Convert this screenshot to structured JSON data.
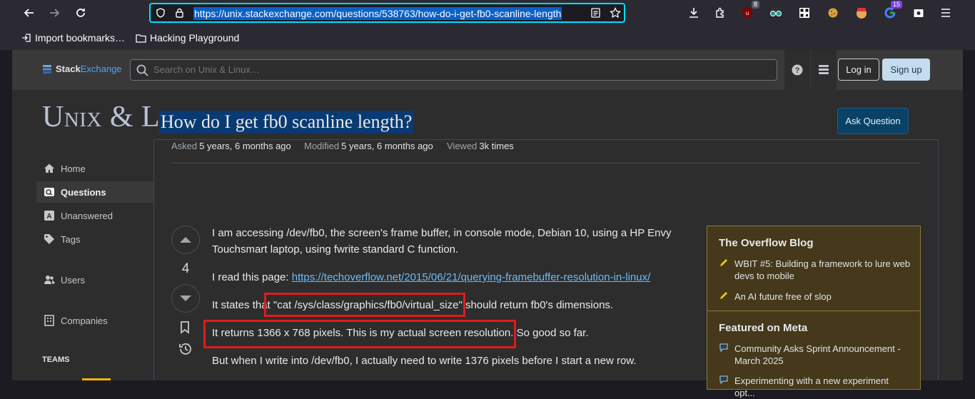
{
  "browser": {
    "url": "https://unix.stackexchange.com/questions/538763/how-do-i-get-fb0-scanline-length",
    "ext_badges": {
      "ublock": "8",
      "google": "15"
    },
    "bookmarks": [
      "Import bookmarks…",
      "Hacking Playground"
    ]
  },
  "site": {
    "logo_part1": "Stack",
    "logo_part2": "Exchange",
    "search_placeholder": "Search on Unix & Linux…",
    "login": "Log in",
    "signup": "Sign up",
    "name": "Unix & Linux"
  },
  "nav": {
    "items": [
      {
        "label": "Home",
        "icon": "home-icon"
      },
      {
        "label": "Questions",
        "icon": "questions-icon"
      },
      {
        "label": "Unanswered",
        "icon": "unanswered-icon"
      },
      {
        "label": "Tags",
        "icon": "tag-icon"
      },
      {
        "label": "Users",
        "icon": "users-icon"
      },
      {
        "label": "Companies",
        "icon": "companies-icon"
      }
    ],
    "teams": "TEAMS"
  },
  "question": {
    "title": "How do I get fb0 scanline length?",
    "ask_button": "Ask Question",
    "asked_label": "Asked",
    "asked_value": "5 years, 6 months ago",
    "modified_label": "Modified",
    "modified_value": "5 years, 6 months ago",
    "viewed_label": "Viewed",
    "viewed_value": "3k times",
    "score": "4",
    "p1": "I am accessing /dev/fb0, the screen's frame buffer, in console mode, Debian 10, using a HP Envy Touchsmart laptop, using fwrite standard C function.",
    "p2_prefix": "I read this page: ",
    "p2_link": "https://techoverflow.net/2015/06/21/querying-framebuffer-resolution-in-linux/",
    "p3": "It states that \"cat /sys/class/graphics/fb0/virtual_size\" should return fb0's dimensions.",
    "p4": "It returns 1366 x 768 pixels. This is my actual screen resolution. So good so far.",
    "p5": "But when I write into /dev/fb0, I actually need to write 1376 pixels before I start a new row."
  },
  "sidebar": {
    "blog_title": "The Overflow Blog",
    "blog_items": [
      "WBIT #5: Building a framework to lure web devs to mobile",
      "An AI future free of slop"
    ],
    "meta_title": "Featured on Meta",
    "meta_items": [
      "Community Asks Sprint Announcement - March 2025",
      "Experimenting with a new experiment opt..."
    ]
  },
  "colors": {
    "accent": "#0a61c7",
    "highlight_box": "#e01b1b",
    "blog_bg": "#45381b"
  }
}
